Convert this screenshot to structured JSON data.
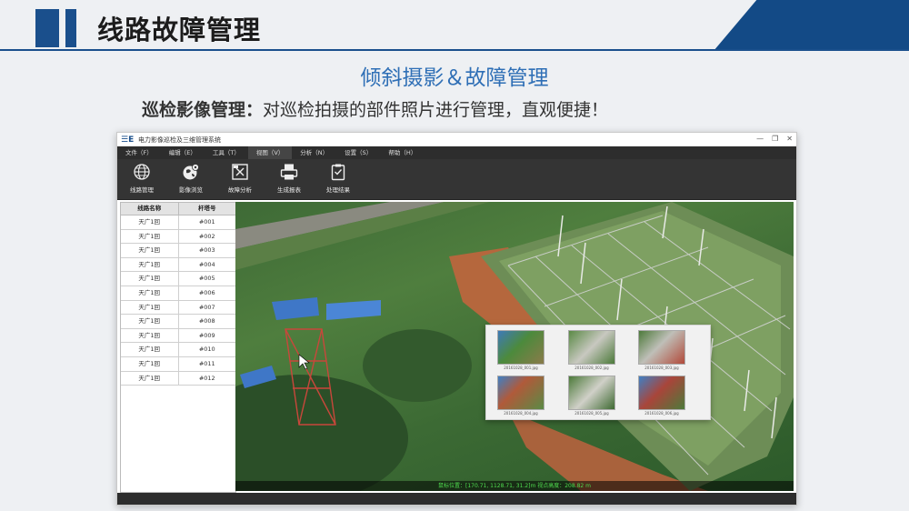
{
  "slide": {
    "title": "线路故障管理",
    "subtitle": "倾斜摄影＆故障管理",
    "desc_bold": "巡检影像管理：",
    "desc_text": "对巡检拍摄的部件照片进行管理，直观便捷！"
  },
  "app": {
    "title": "电力影像巡检及三维管理系统",
    "window_controls": [
      "—",
      "❐",
      "✕"
    ],
    "menu": [
      "文件（F）",
      "编辑（E）",
      "工具（T）",
      "视图（V）",
      "分析（N）",
      "设置（S）",
      "帮助（H）"
    ],
    "active_menu_index": 3,
    "toolbar": [
      {
        "label": "线路管理",
        "icon": "globe-icon"
      },
      {
        "label": "影像浏览",
        "icon": "earth-pin-icon"
      },
      {
        "label": "故障分析",
        "icon": "analysis-icon"
      },
      {
        "label": "生成报表",
        "icon": "printer-icon"
      },
      {
        "label": "处理结果",
        "icon": "clipboard-icon"
      }
    ],
    "table": {
      "headers": [
        "线路名称",
        "杆塔号"
      ],
      "rows": [
        [
          "天广1回",
          "#001"
        ],
        [
          "天广1回",
          "#002"
        ],
        [
          "天广1回",
          "#003"
        ],
        [
          "天广1回",
          "#004"
        ],
        [
          "天广1回",
          "#005"
        ],
        [
          "天广1回",
          "#006"
        ],
        [
          "天广1回",
          "#007"
        ],
        [
          "天广1回",
          "#008"
        ],
        [
          "天广1回",
          "#009"
        ],
        [
          "天广1回",
          "#010"
        ],
        [
          "天广1回",
          "#011"
        ],
        [
          "天广1回",
          "#012"
        ]
      ]
    },
    "coord_readout": "鼠标位置：[170.71, 1128.71, 31.2]m   视点高度：208.82 m",
    "thumbnail_captions": [
      "20161028_001.jpg",
      "20161028_002.jpg",
      "20161028_003.jpg",
      "20161028_004.jpg",
      "20161028_005.jpg",
      "20161028_006.jpg"
    ],
    "colors": {
      "accent": "#1a4f8c",
      "dark_bar": "#2d2d2d",
      "coord_text": "#4fdc4f"
    }
  }
}
